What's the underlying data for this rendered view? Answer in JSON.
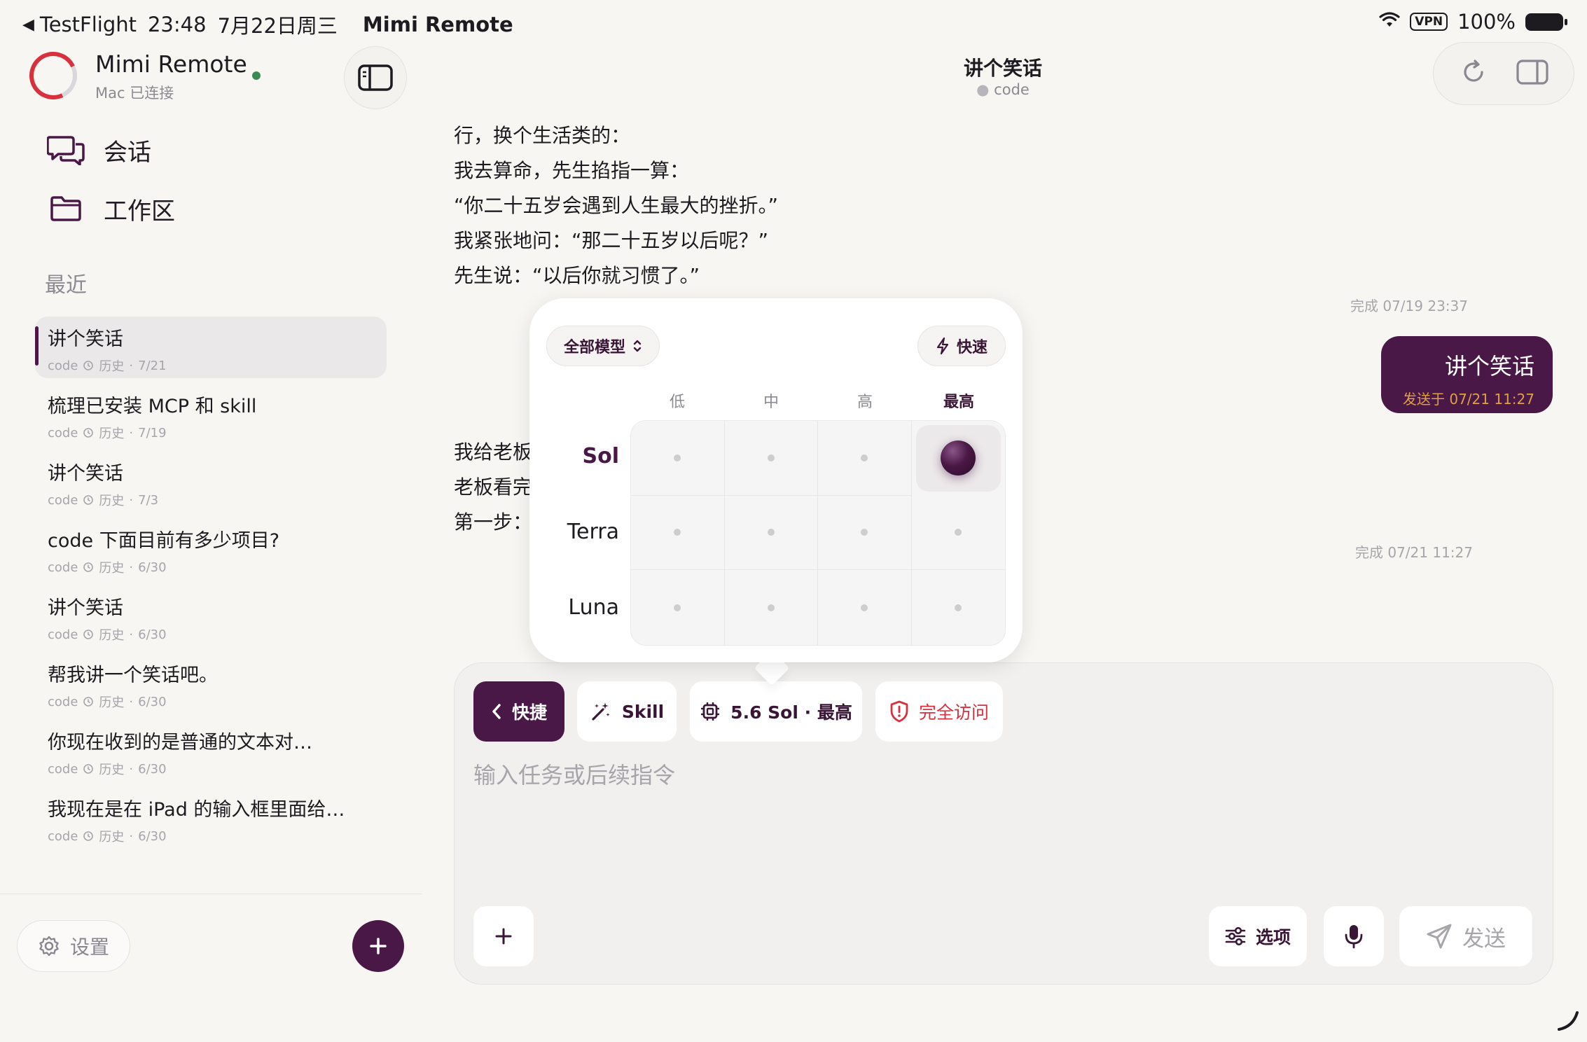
{
  "status_bar": {
    "back_app": "TestFlight",
    "time": "23:48",
    "date": "7月22日周三",
    "app_name": "Mimi Remote",
    "vpn": "VPN",
    "battery": "100%"
  },
  "sidebar": {
    "title": "Mimi Remote",
    "subtitle": "Mac 已连接",
    "nav": [
      {
        "label": "会话",
        "icon": "chat-bubbles-icon"
      },
      {
        "label": "工作区",
        "icon": "folder-icon"
      }
    ],
    "recent_label": "最近",
    "conversations": [
      {
        "title": "讲个笑话",
        "project": "code",
        "history": "历史",
        "date": "7/21",
        "active": true
      },
      {
        "title": "梳理已安装 MCP 和 skill",
        "project": "code",
        "history": "历史",
        "date": "7/19"
      },
      {
        "title": "讲个笑话",
        "project": "code",
        "history": "历史",
        "date": "7/3"
      },
      {
        "title": "code 下面目前有多少项目?",
        "project": "code",
        "history": "历史",
        "date": "6/30"
      },
      {
        "title": "讲个笑话",
        "project": "code",
        "history": "历史",
        "date": "6/30"
      },
      {
        "title": "帮我讲一个笑话吧。",
        "project": "code",
        "history": "历史",
        "date": "6/30"
      },
      {
        "title": "你现在收到的是普通的文本对…",
        "project": "code",
        "history": "历史",
        "date": "6/30"
      },
      {
        "title": "我现在是在 iPad 的输入框里面给…",
        "project": "code",
        "history": "历史",
        "date": "6/30"
      }
    ],
    "settings_label": "设置"
  },
  "chat": {
    "title": "讲个笑话",
    "subtitle": "code",
    "assistant_lines": [
      "行，换个生活类的：",
      "我去算命，先生掐指一算：",
      "“你二十五岁会遇到人生最大的挫折。”",
      "我紧张地问：“那二十五岁以后呢？”",
      "先生说：“以后你就习惯了。”"
    ],
    "done_1": "完成 07/19 23:37",
    "user_message": "讲个笑话",
    "user_sent": "发送于 07/21 11:27",
    "assistant2_lines": [
      "我给老板",
      "老板看完",
      "第一步："
    ],
    "done_2": "完成 07/21 11:27"
  },
  "model_popup": {
    "filter_label": "全部模型",
    "fast_label": "快速",
    "levels": [
      "低",
      "中",
      "高",
      "最高"
    ],
    "models": [
      "Sol",
      "Terra",
      "Luna"
    ],
    "selected_model": "Sol",
    "selected_level": "最高"
  },
  "composer": {
    "quick_label": "快捷",
    "skill_label": "Skill",
    "model_label": "5.6 Sol · 最高",
    "access_label": "完全访问",
    "placeholder": "输入任务或后续指令",
    "options_label": "选项",
    "send_label": "发送"
  },
  "colors": {
    "accent": "#4a1846",
    "danger": "#d9303e",
    "online": "#3b8a52",
    "sent_time": "#e0a040"
  }
}
